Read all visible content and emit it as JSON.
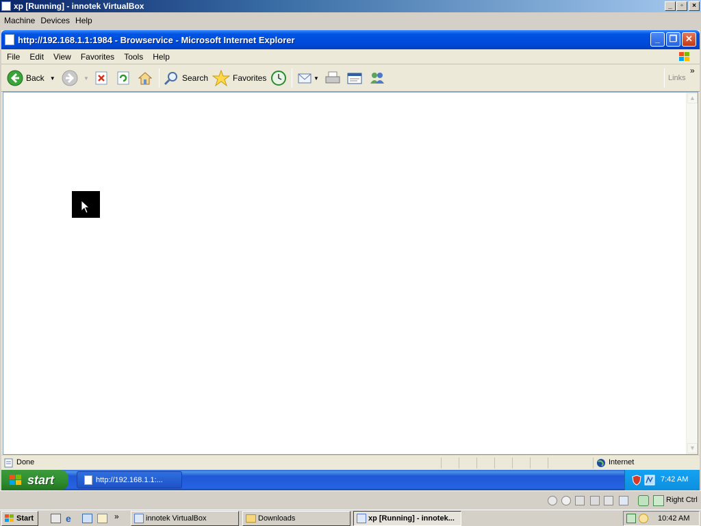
{
  "host": {
    "title": "xp [Running] - innotek VirtualBox",
    "menu": [
      "Machine",
      "Devices",
      "Help"
    ],
    "status": {
      "host_key": "Right Ctrl"
    },
    "taskbar": {
      "start_label": "Start",
      "buttons": [
        {
          "label": "innotek VirtualBox"
        },
        {
          "label": "Downloads"
        },
        {
          "label": "xp [Running] - innotek..."
        }
      ],
      "clock": "10:42 AM"
    }
  },
  "ie": {
    "title": "http://192.168.1.1:1984 - Browservice - Microsoft Internet Explorer",
    "menu": [
      "File",
      "Edit",
      "View",
      "Favorites",
      "Tools",
      "Help"
    ],
    "toolbar": {
      "back_label": "Back",
      "search_label": "Search",
      "favorites_label": "Favorites",
      "links_label": "Links"
    },
    "status": {
      "text": "Done",
      "zone": "Internet"
    }
  },
  "guest_taskbar": {
    "start_label": "start",
    "task_label": "http://192.168.1.1:...",
    "clock": "7:42 AM"
  },
  "colors": {
    "xp_blue": "#0054e3",
    "start_green": "#2f8b2f",
    "host_title": "#0a246a"
  }
}
